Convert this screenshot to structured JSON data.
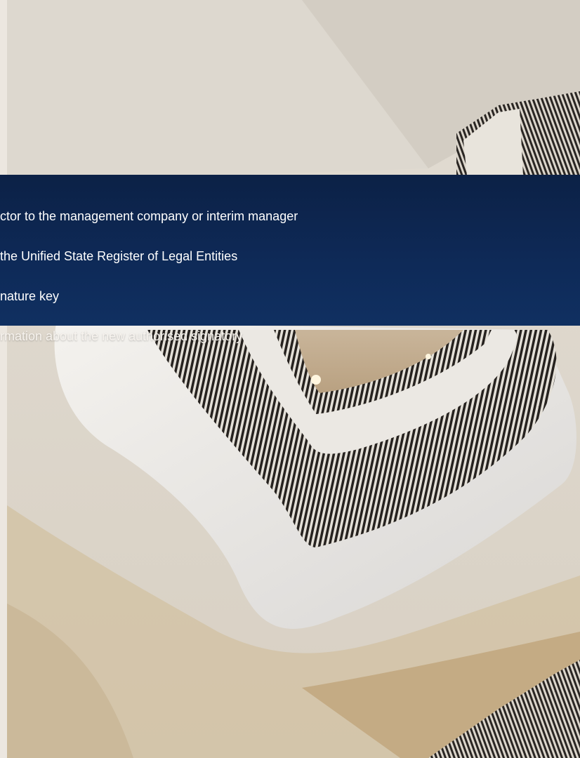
{
  "steps": [
    {
      "text": "ctor to the management company or interim manager"
    },
    {
      "text": "the Unified State Register of Legal Entities"
    },
    {
      "text": "nature key"
    },
    {
      "text": "rmation about the new authorised signatory"
    }
  ],
  "image": {
    "subject": "spiral-staircase-photo"
  },
  "colors": {
    "overlay": "#0e2a58",
    "text": "#ffffff",
    "wall": "#ddd6cb",
    "railing": "#2b2622"
  }
}
